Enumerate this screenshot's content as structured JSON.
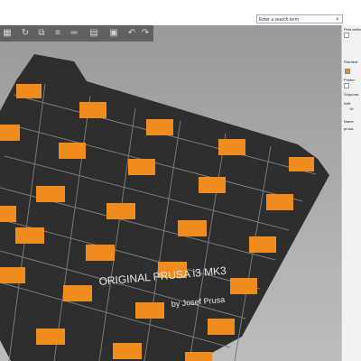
{
  "search": {
    "placeholder": "Enter a search term"
  },
  "toolbar": {
    "buttons": [
      "layout-icon",
      "rotate-icon",
      "copy-icon",
      "layers-icon",
      "ruler-icon",
      "arrange-icon",
      "undo-icon",
      "redo-icon"
    ]
  },
  "sidebar": {
    "print_settings_label": "Print settin",
    "filament_label": "Filament:",
    "printer_label": "Printer:",
    "supports_label": "Supports:",
    "infill_label": "Infill:",
    "infill_value": "15",
    "name_header": "Name",
    "object_name": "prusa-"
  },
  "bed": {
    "title": "ORIGINAL PRUSA i3 MK3",
    "subtitle": "by Josef Prusa"
  },
  "colors": {
    "accent": "#f08c1e",
    "bed": "#2e2e2e",
    "viewport": "#a8a8a8"
  }
}
